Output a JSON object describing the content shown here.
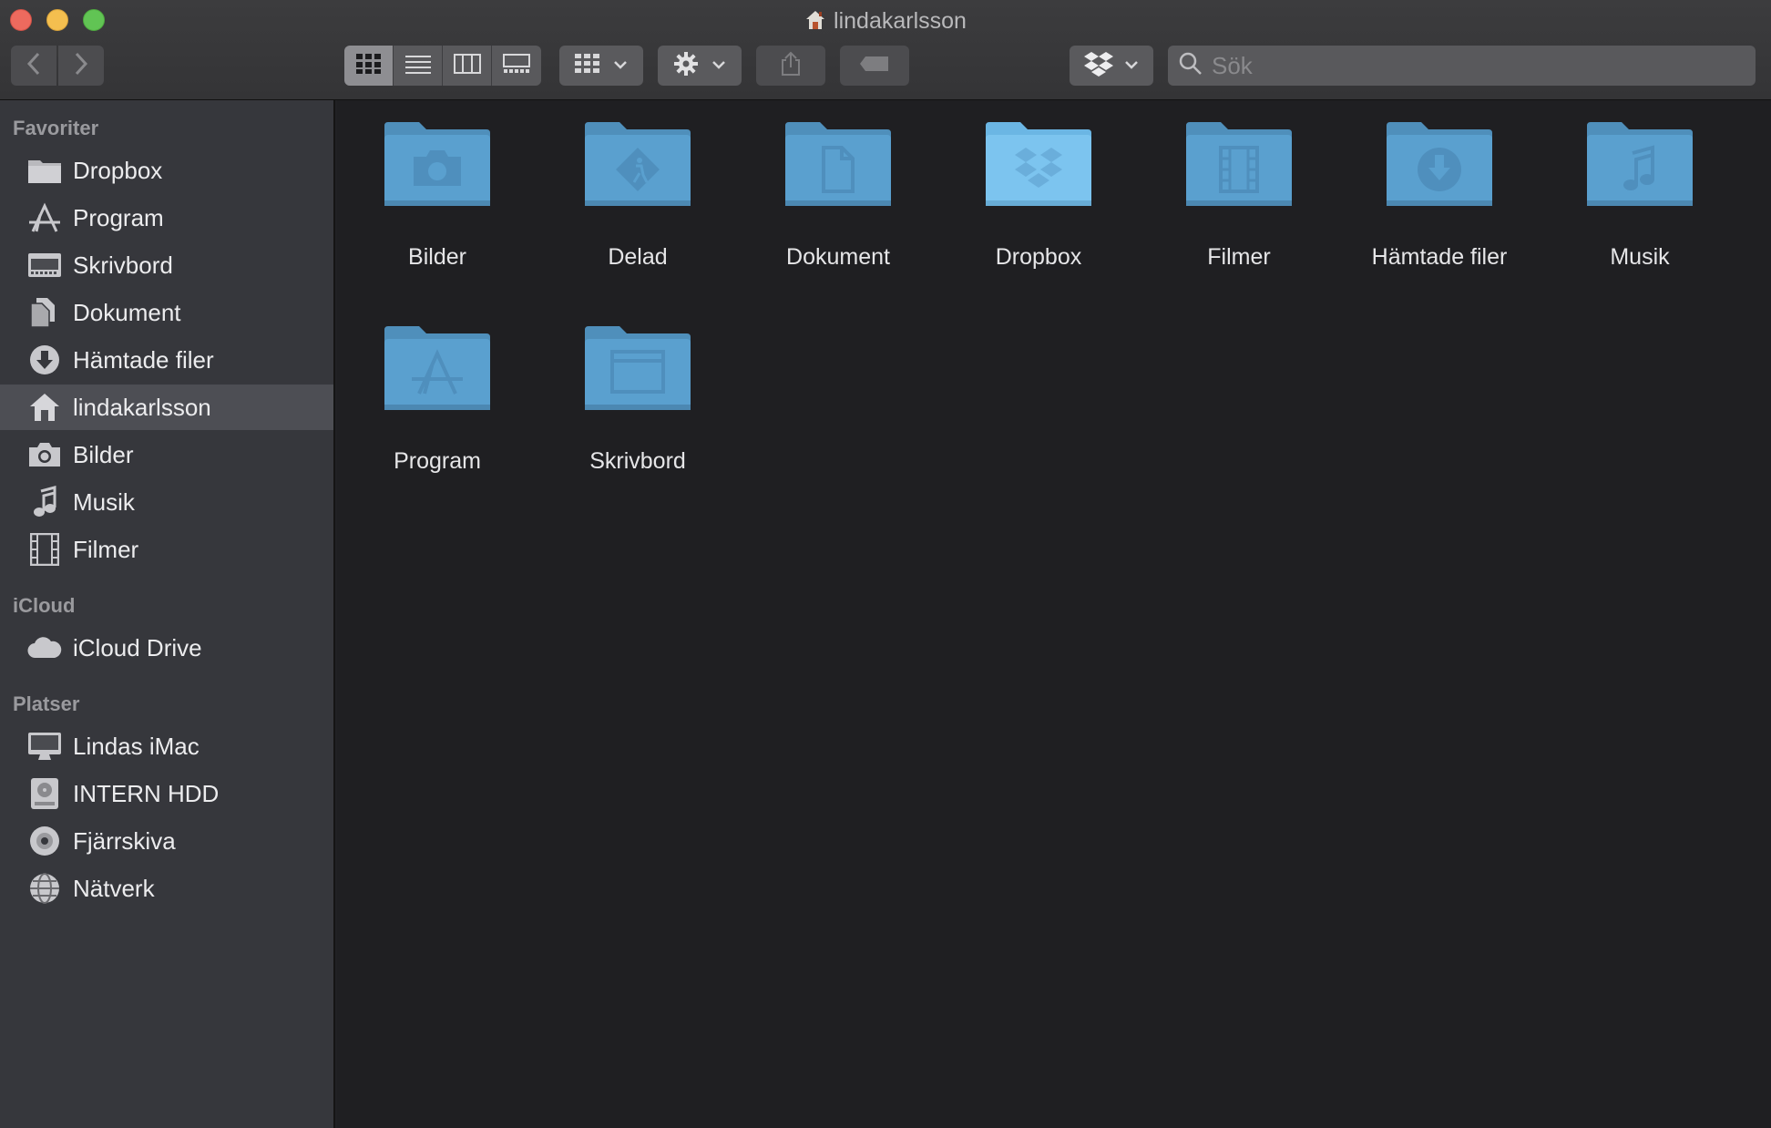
{
  "window": {
    "title": "lindakarlsson"
  },
  "toolbar": {
    "back_icon": "chevron-left-icon",
    "forward_icon": "chevron-right-icon",
    "views": [
      "icon-view-icon",
      "list-view-icon",
      "column-view-icon",
      "gallery-view-icon"
    ],
    "active_view": "icon-view-icon",
    "group_icon": "group-grid-icon",
    "action_icon": "gear-icon",
    "share_icon": "share-icon",
    "tag_icon": "tag-icon",
    "dropbox_icon": "dropbox-icon"
  },
  "search": {
    "placeholder": "Sök",
    "value": ""
  },
  "sidebar": {
    "favorites_title": "Favoriter",
    "favorites": [
      {
        "label": "Dropbox",
        "icon": "folder-icon"
      },
      {
        "label": "Program",
        "icon": "apps-icon"
      },
      {
        "label": "Skrivbord",
        "icon": "desktop-icon"
      },
      {
        "label": "Dokument",
        "icon": "documents-icon"
      },
      {
        "label": "Hämtade filer",
        "icon": "downloads-icon"
      },
      {
        "label": "lindakarlsson",
        "icon": "home-icon",
        "selected": true
      },
      {
        "label": "Bilder",
        "icon": "camera-icon"
      },
      {
        "label": "Musik",
        "icon": "music-note-icon"
      },
      {
        "label": "Filmer",
        "icon": "film-icon"
      }
    ],
    "icloud_title": "iCloud",
    "icloud": [
      {
        "label": "iCloud Drive",
        "icon": "cloud-icon"
      }
    ],
    "places_title": "Platser",
    "places": [
      {
        "label": "Lindas iMac",
        "icon": "imac-icon"
      },
      {
        "label": "INTERN HDD",
        "icon": "hard-drive-icon"
      },
      {
        "label": "Fjärrskiva",
        "icon": "disc-icon"
      },
      {
        "label": "Nätverk",
        "icon": "network-icon"
      }
    ]
  },
  "content": {
    "items": [
      {
        "label": "Bilder",
        "icon": "camera-folder-icon"
      },
      {
        "label": "Delad",
        "icon": "public-folder-icon"
      },
      {
        "label": "Dokument",
        "icon": "document-folder-icon"
      },
      {
        "label": "Dropbox",
        "icon": "dropbox-folder-icon"
      },
      {
        "label": "Filmer",
        "icon": "film-folder-icon"
      },
      {
        "label": "Hämtade filer",
        "icon": "downloads-folder-icon"
      },
      {
        "label": "Musik",
        "icon": "music-folder-icon"
      },
      {
        "label": "Program",
        "icon": "apps-folder-icon"
      },
      {
        "label": "Skrivbord",
        "icon": "desktop-folder-icon"
      }
    ]
  },
  "colors": {
    "folder": "#5a9fcd",
    "folder_dropbox": "#7cc3ee",
    "sidebar_bg": "#36373c",
    "content_bg": "#1f1f22",
    "selected_bg": "#4d4e54"
  }
}
